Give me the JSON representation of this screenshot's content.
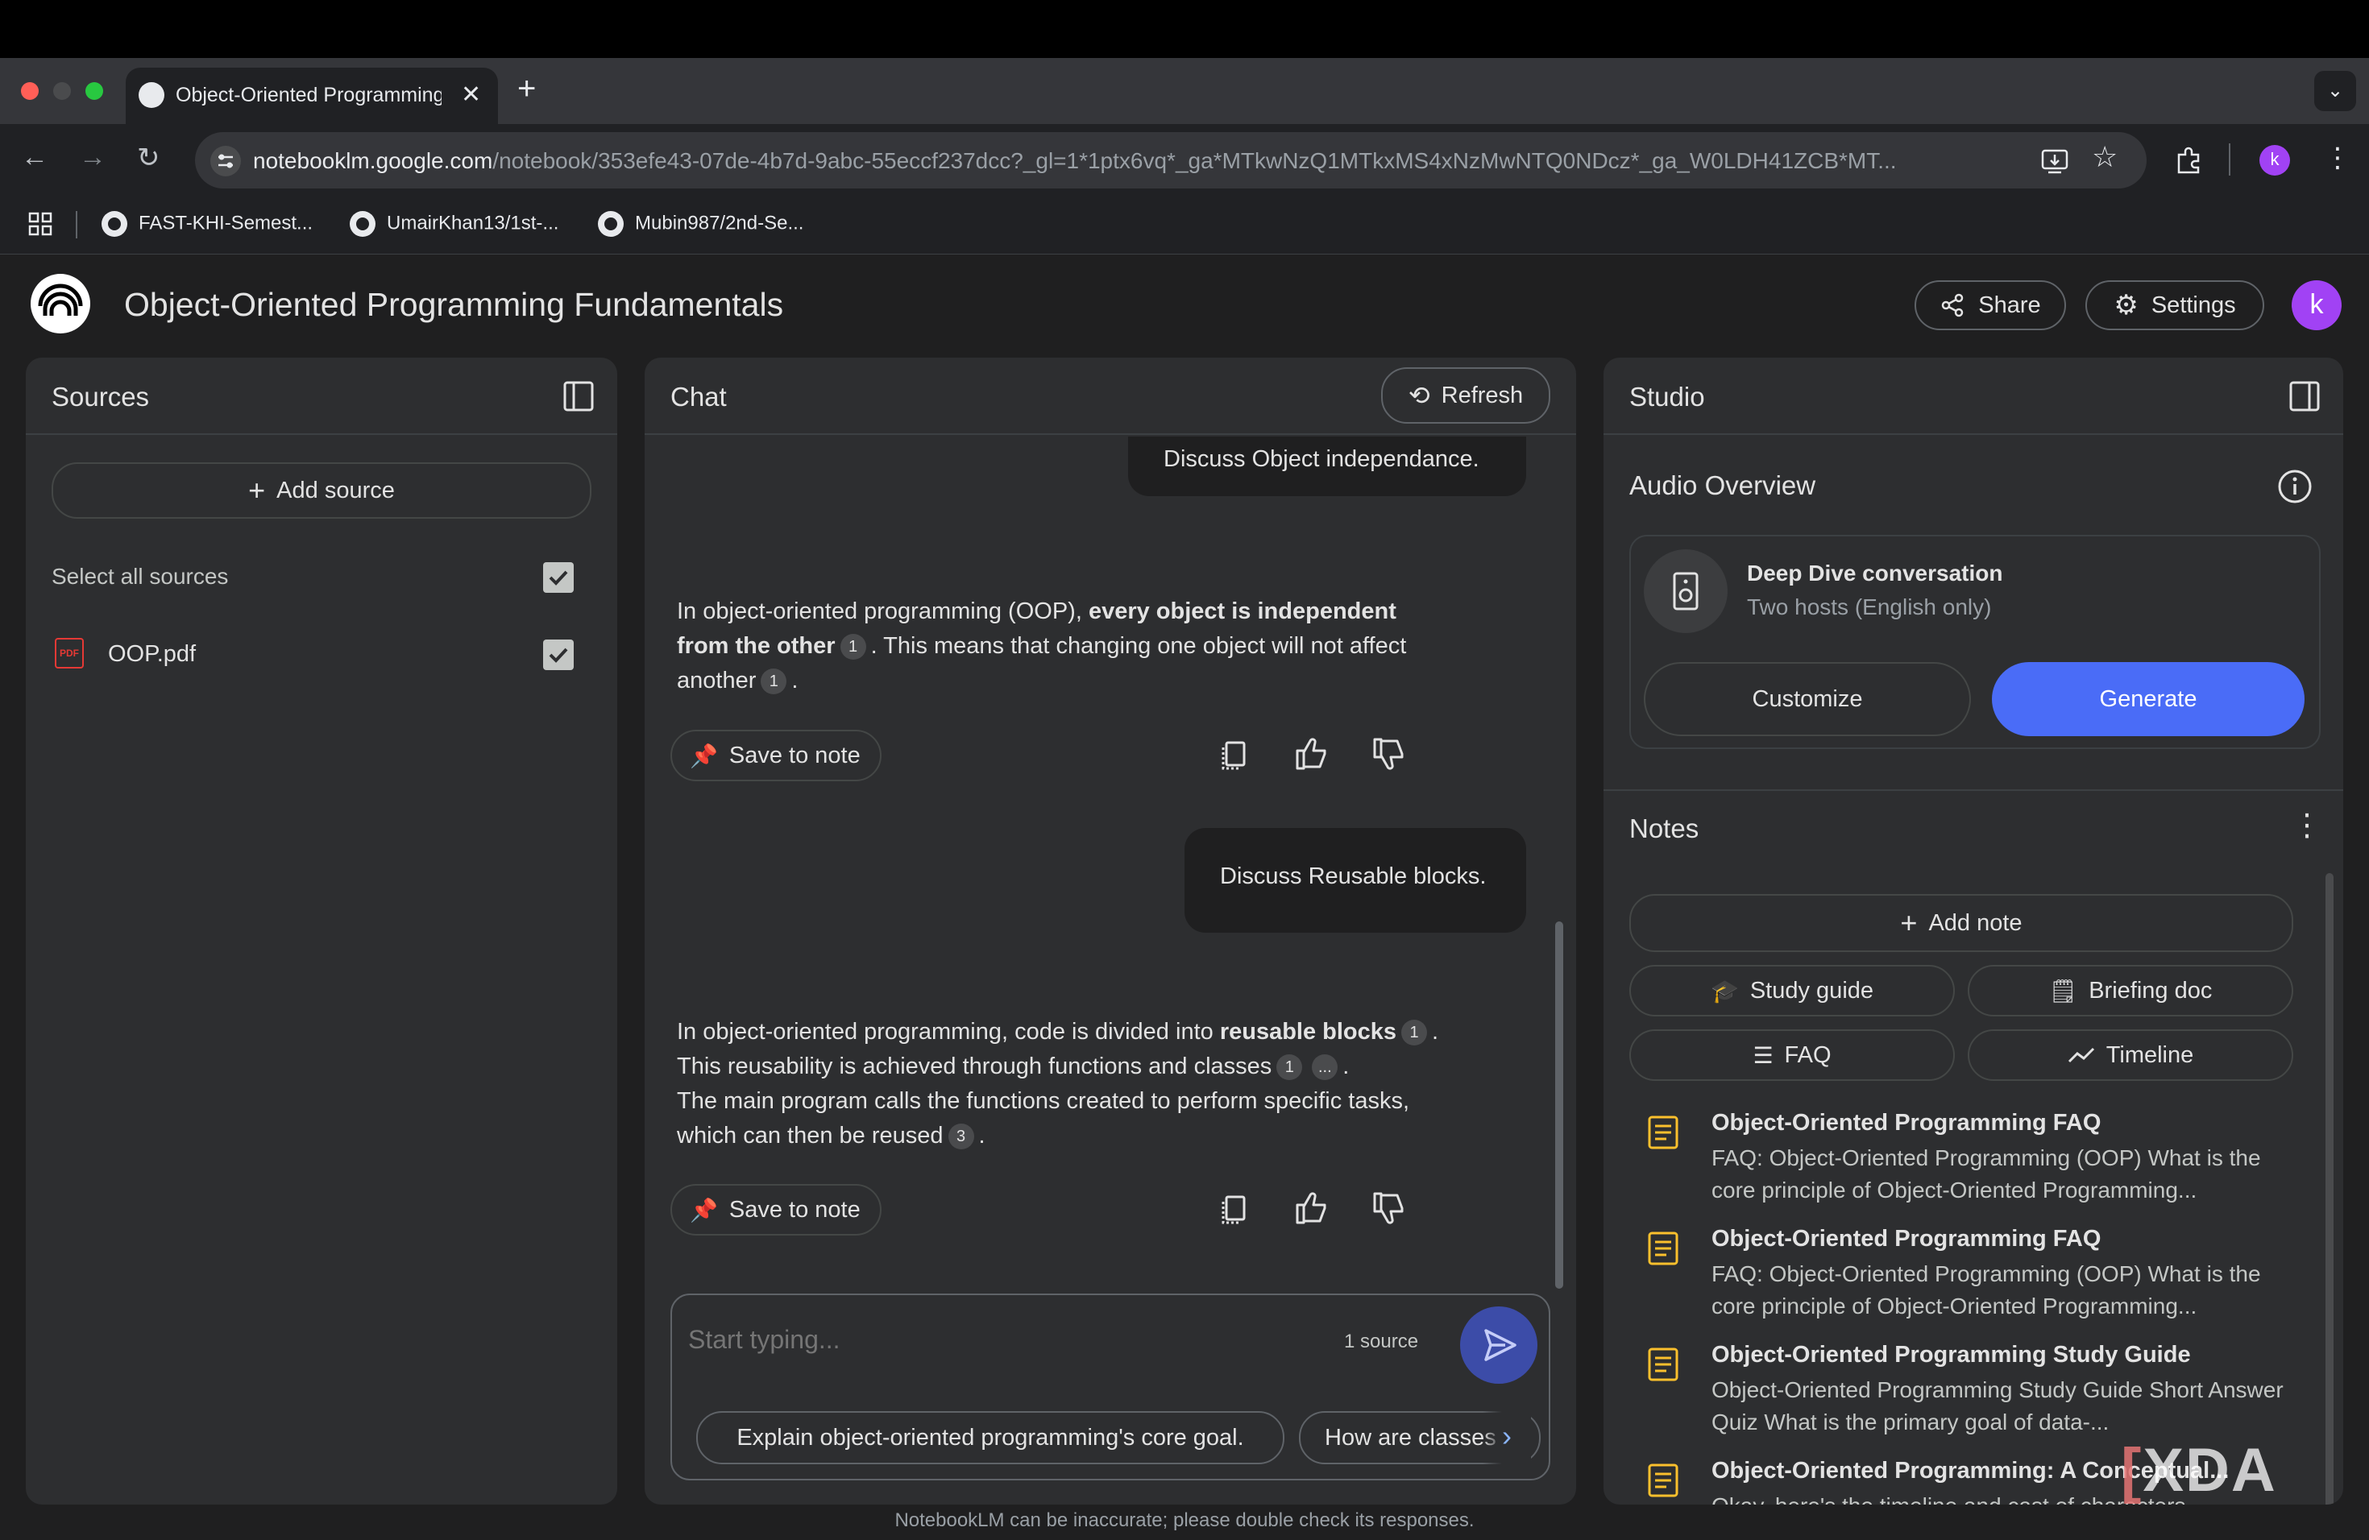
{
  "browser": {
    "tab_title": "Object-Oriented Programming Fundamentals",
    "url_host": "notebooklm.google.com",
    "url_rest": "/notebook/353efe43-07de-4b7d-9abc-55eccf237dcc?_gl=1*1ptx6vq*_ga*MTkwNzQ1MTkxMS4xNzMwNTQ0NDcz*_ga_W0LDH41ZCB*MT...",
    "profile_initial": "k",
    "bookmarks": [
      "FAST-KHI-Semest...",
      "UmairKhan13/1st-...",
      "Mubin987/2nd-Se..."
    ]
  },
  "app": {
    "title": "Object-Oriented Programming Fundamentals",
    "share_label": "Share",
    "settings_label": "Settings",
    "avatar_initial": "k",
    "footer": "NotebookLM can be inaccurate; please double check its responses."
  },
  "sources": {
    "title": "Sources",
    "add_source": "Add source",
    "select_all": "Select all sources",
    "items": [
      {
        "name": "OOP.pdf",
        "icon_label": "PDF",
        "checked": true
      }
    ]
  },
  "chat": {
    "title": "Chat",
    "refresh": "Refresh",
    "messages": [
      {
        "role": "user",
        "text": "Discuss Object independance."
      },
      {
        "role": "assistant",
        "parts": [
          "In object-oriented programming (OOP), ",
          "every object is independent from the other",
          ". This means that changing one object will not affect another",
          "."
        ],
        "citations": [
          "1",
          "1"
        ]
      },
      {
        "role": "user",
        "text": "Discuss Reusable blocks."
      },
      {
        "role": "assistant",
        "parts": [
          "In object-oriented programming, code is divided into ",
          "reusable blocks",
          ". This reusability is achieved through functions and classes",
          ".",
          "The main program calls the functions created to perform specific tasks, which can then be reused",
          "."
        ],
        "citations": [
          "1",
          "1",
          "...",
          "3"
        ]
      }
    ],
    "save_to_note": "Save to note",
    "input_placeholder": "Start typing...",
    "source_count": "1 source",
    "suggestions": [
      "Explain object-oriented programming's core goal.",
      "How are classes"
    ]
  },
  "studio": {
    "title": "Studio",
    "audio_title": "Audio Overview",
    "audio_card_title": "Deep Dive conversation",
    "audio_card_subtitle": "Two hosts (English only)",
    "customize": "Customize",
    "generate": "Generate",
    "notes_title": "Notes",
    "add_note": "Add note",
    "quick_actions": [
      "Study guide",
      "Briefing doc",
      "FAQ",
      "Timeline"
    ],
    "notes": [
      {
        "title": "Object-Oriented Programming FAQ",
        "body": "FAQ: Object-Oriented Programming (OOP) What is the core principle of Object-Oriented Programming..."
      },
      {
        "title": "Object-Oriented Programming FAQ",
        "body": "FAQ: Object-Oriented Programming (OOP) What is the core principle of Object-Oriented Programming..."
      },
      {
        "title": "Object-Oriented Programming Study Guide",
        "body": "Object-Oriented Programming Study Guide Short Answer Quiz What is the primary goal of data-..."
      },
      {
        "title": "Object-Oriented Programming: A Conceptual...",
        "body": "Okay, here's the timeline and cast of characters..."
      }
    ]
  },
  "watermark": "XDA",
  "colors": {
    "accent": "#4a6cf7",
    "panel": "#2d2e30",
    "avatar": "#a142f4",
    "note_icon": "#fbc02d"
  }
}
